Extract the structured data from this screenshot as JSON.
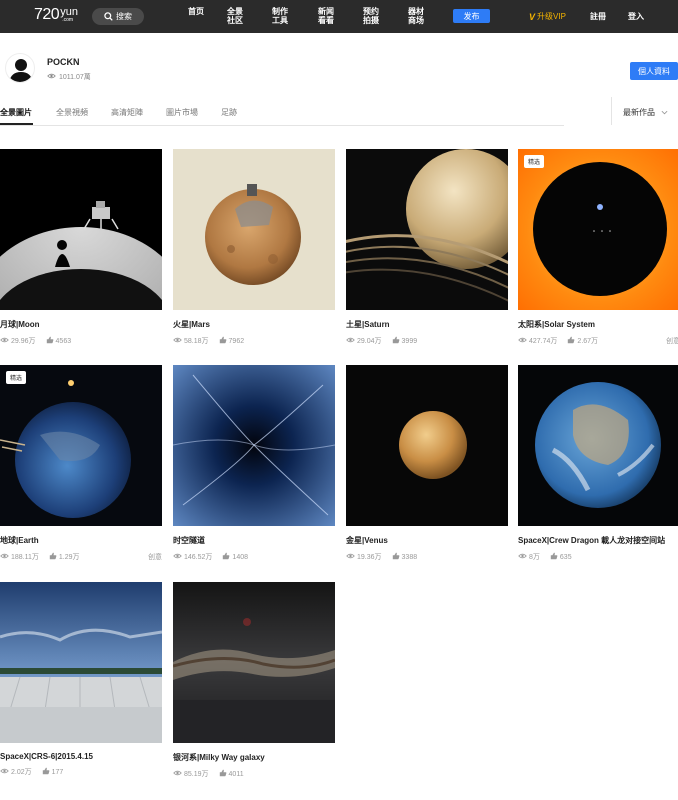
{
  "header": {
    "logo_number": "720",
    "logo_word": "yun",
    "logo_sub": ".com",
    "search_label": "搜索",
    "nav": [
      {
        "label": "首页"
      },
      {
        "label": "全景社区"
      },
      {
        "label": "制作工具"
      },
      {
        "label": "新闻看看"
      },
      {
        "label": "预约拍摄"
      },
      {
        "label": "器材商场"
      }
    ],
    "publish_label": "发布",
    "vip_label": "升级VIP",
    "register_label": "註冊",
    "login_label": "登入"
  },
  "profile": {
    "username": "POCKN",
    "views": "1011.07萬",
    "profile_button": "個人資料"
  },
  "tabs": [
    {
      "label": "全景圖片",
      "active": true
    },
    {
      "label": "全景視頻",
      "active": false
    },
    {
      "label": "高清矩陣",
      "active": false
    },
    {
      "label": "圖片市場",
      "active": false
    },
    {
      "label": "足跡",
      "active": false
    }
  ],
  "sort_label": "最新作品",
  "cards": [
    {
      "title": "月球|Moon",
      "views": "29.96万",
      "likes": "4563",
      "badge": "",
      "tag": "",
      "image": "moon"
    },
    {
      "title": "火星|Mars",
      "views": "58.18万",
      "likes": "7962",
      "badge": "",
      "tag": "",
      "image": "mars"
    },
    {
      "title": "土星|Saturn",
      "views": "29.04万",
      "likes": "3999",
      "badge": "",
      "tag": "",
      "image": "saturn"
    },
    {
      "title": "太阳系|Solar System",
      "views": "427.74万",
      "likes": "2.67万",
      "badge": "精选",
      "tag": "创意",
      "image": "sun"
    },
    {
      "title": "地球|Earth",
      "views": "188.11万",
      "likes": "1.29万",
      "badge": "精选",
      "tag": "创意",
      "image": "earth"
    },
    {
      "title": "时空隧道",
      "views": "146.52万",
      "likes": "1408",
      "badge": "",
      "tag": "",
      "image": "tunnel"
    },
    {
      "title": "金星|Venus",
      "views": "19.36万",
      "likes": "3388",
      "badge": "",
      "tag": "",
      "image": "venus"
    },
    {
      "title": "SpaceX|Crew Dragon 載人龙对接空间站",
      "views": "8万",
      "likes": "635",
      "badge": "",
      "tag": "",
      "image": "globe"
    },
    {
      "title": "SpaceX|CRS-6|2015.4.15",
      "views": "2.02万",
      "likes": "177",
      "badge": "",
      "tag": "",
      "image": "pad"
    },
    {
      "title": "银河系|Milky Way galaxy",
      "views": "85.19万",
      "likes": "4011",
      "badge": "",
      "tag": "",
      "image": "milkyway"
    }
  ],
  "colors": {
    "accent": "#2e7cf6",
    "topbar": "#2b2b2b",
    "vip": "#f5b400"
  }
}
